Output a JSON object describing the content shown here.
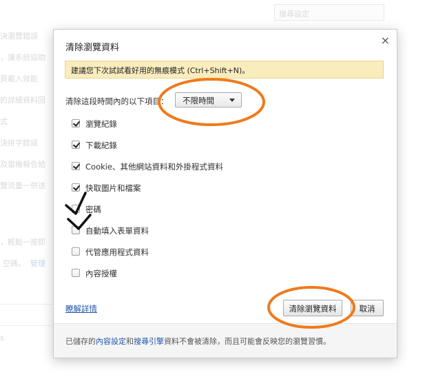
{
  "background": {
    "search_placeholder": "搜尋設定",
    "lines": [
      "決瀏覽錯誤",
      "，讓系統協助",
      "頁載入效能",
      "的詳細資料回",
      "式",
      "決拼字錯誤",
      "及當機報告給",
      "覽流量一併送",
      "，輕鬆一按即",
      "空碼。",
      "管理",
      "s"
    ],
    "link_text": "管理"
  },
  "dialog": {
    "title": "清除瀏覽資料",
    "close_glyph": "×",
    "banner": "建議您下次試試看好用的無痕模式 (Ctrl+Shift+N)。",
    "range_label": "清除這段時間內的以下項目：",
    "range_value": "不限時間",
    "options": [
      {
        "label": "瀏覽紀錄",
        "checked": true
      },
      {
        "label": "下載紀錄",
        "checked": true
      },
      {
        "label": "Cookie、其他網站資料和外掛程式資料",
        "checked": true
      },
      {
        "label": "快取圖片和檔案",
        "checked": true
      },
      {
        "label": "密碼",
        "checked": false
      },
      {
        "label": "自動填入表單資料",
        "checked": false
      },
      {
        "label": "代管應用程式資料",
        "checked": false
      },
      {
        "label": "內容授權",
        "checked": false
      }
    ],
    "learn_more": "瞭解詳情",
    "clear_button": "清除瀏覽資料",
    "cancel_button": "取消",
    "footer": {
      "prefix": "已儲存的",
      "link1": "內容設定",
      "middle": "和",
      "link2": "搜尋引擎",
      "suffix": "資料不會被清除，而且可能會反映您的瀏覽習慣。"
    }
  },
  "annotation_color": "#f07a1c"
}
